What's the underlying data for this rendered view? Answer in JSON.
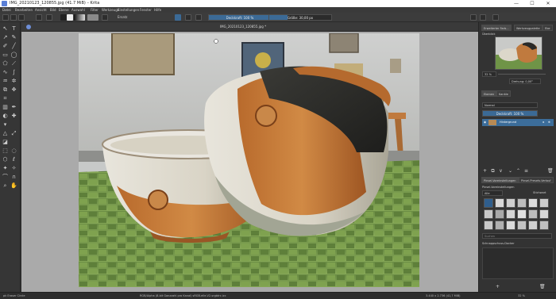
{
  "window": {
    "title": "IMG_20210123_120855.jpg (41.7 MiB)  –  Krita",
    "minimize": "—",
    "maximize": "☐",
    "close": "✕"
  },
  "menu": [
    "Datei",
    "Bearbeiten",
    "Ansicht",
    "Bild",
    "Ebene",
    "Auswahl",
    "Filter",
    "Werkzeuge",
    "Einstellungen",
    "Fenster",
    "Hilfe"
  ],
  "toolbar": {
    "preset": "Ersatz",
    "opacity_label": "Deckkraft: 100 %",
    "opacity_value": 1.0,
    "size_label": "Größe: 30,00 px",
    "size_fraction": 0.3
  },
  "document": {
    "tab_title": "IMG_20210123_120855.jpg *"
  },
  "dock": {
    "tabs": [
      "Erweiterter Farb…",
      "Werkzeugpalette",
      "Ebe"
    ],
    "overview_label": "Überblick",
    "zoom_label": "32 %",
    "rotation_label": "Drehung: 0,00°",
    "layers_tabs": [
      "Ebenen",
      "Kanäle"
    ],
    "blend_mode": "Normal",
    "layer_opacity": "Deckkraft: 100 %",
    "layer_name": "Hintergrund",
    "brush_tabs": [
      "Pinsel-Voreinstellungen",
      "Pinsel-Presets-Verlauf"
    ],
    "brush_filter_label": "Pinsel-Voreinstellungen",
    "brush_filter_all": "Alle",
    "brush_tag_label": "Stichwort",
    "brush_search": "Suchen",
    "snapshot_label": "Schnappschuss-Docker"
  },
  "status": {
    "tool": "pk Eraser Circle",
    "color": "RGB/Alpha (8-bit Ganzzahl pro Kanal)  sRGB-elle-V2-srgbtrc.icc",
    "dimensions": "3.440 x 2.736 (41,7 MiB)",
    "zoom": "32 %"
  },
  "colors": {
    "accent": "#3b6a96",
    "panel": "#333333",
    "canvas_bg": "#aaaaaa"
  }
}
